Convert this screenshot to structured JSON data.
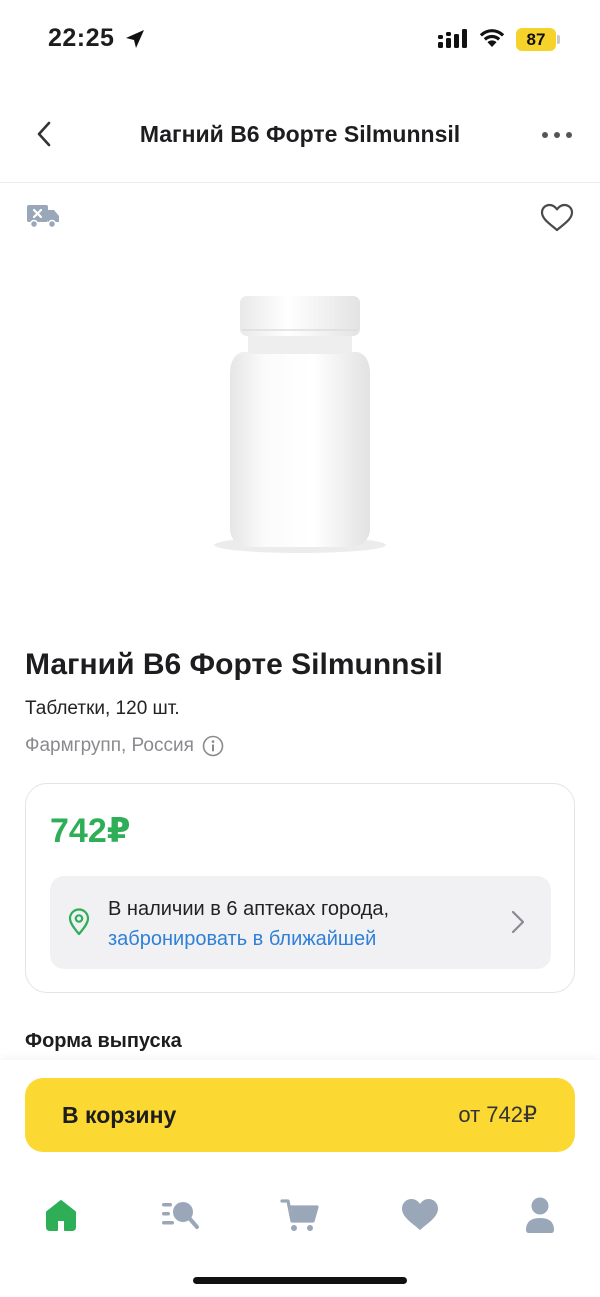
{
  "status": {
    "time": "22:25",
    "battery": "87"
  },
  "nav": {
    "title": "Магний В6 Форте Silmunnsil"
  },
  "icons": {
    "back": "chevron-left-icon",
    "more": "more-dots-icon",
    "no_delivery": "truck-cross-icon",
    "favorite": "heart-outline-icon",
    "info": "info-icon",
    "pin": "location-pin-icon",
    "chevron": "chevron-right-icon"
  },
  "product": {
    "name": "Магний В6 Форте Silmunnsil",
    "form": "Таблетки, 120 шт.",
    "manufacturer": "Фармгрупп, Россия",
    "image": "white-pill-bottle"
  },
  "price_card": {
    "price": "742₽",
    "stock_text": "В наличии в 6 аптеках города,",
    "stock_link": "забронировать в ближайшей"
  },
  "sections": {
    "form_title": "Форма выпуска"
  },
  "cart_button": {
    "label": "В корзину",
    "price": "от 742₽"
  },
  "tabbar": {
    "items": [
      {
        "icon": "home-icon",
        "active": true
      },
      {
        "icon": "catalog-search-icon",
        "active": false
      },
      {
        "icon": "cart-icon",
        "active": false
      },
      {
        "icon": "heart-icon",
        "active": false
      },
      {
        "icon": "profile-icon",
        "active": false
      }
    ]
  },
  "colors": {
    "accent_green": "#2dae57",
    "cart_yellow": "#fcd832",
    "link_blue": "#2f80d6",
    "inactive_icon": "#9aa7b8"
  }
}
